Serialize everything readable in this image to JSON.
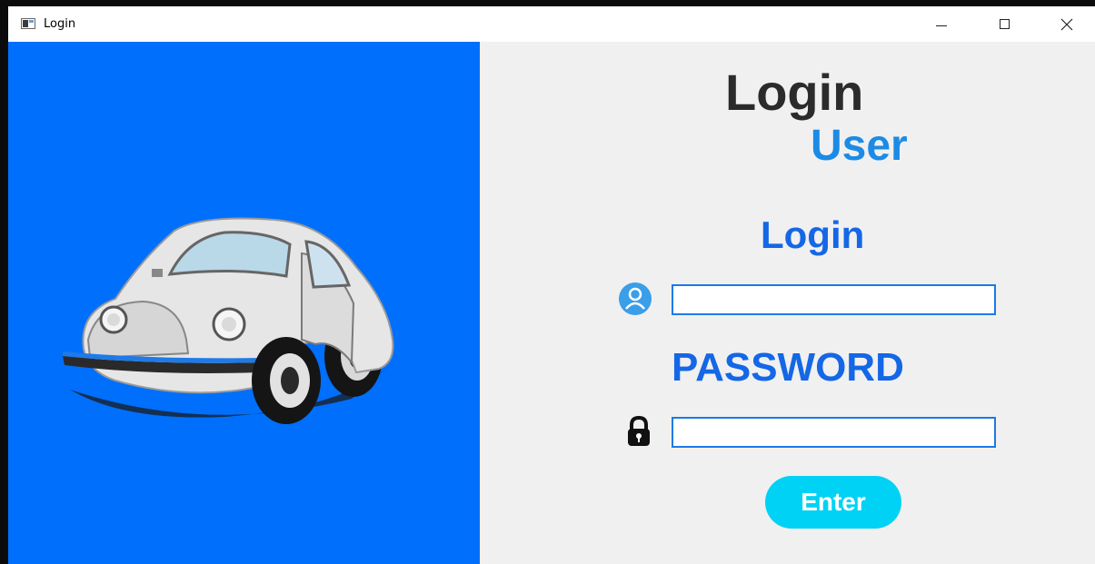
{
  "window": {
    "title": "Login",
    "controls": {
      "minimize": "minimize-icon",
      "maximize": "maximize-icon",
      "close": "close-icon"
    }
  },
  "left_panel": {
    "background": "#006ffb",
    "image": "car-illustration"
  },
  "right_panel": {
    "heading": "Login",
    "subheading": "User",
    "username_label": "Login",
    "username_value": "",
    "password_label": "PASSWORD",
    "password_value": "",
    "submit_label": "Enter",
    "icons": {
      "username": "user-icon",
      "password": "lock-icon"
    },
    "colors": {
      "accent": "#1467e6",
      "button": "#00d2f5",
      "heading": "#2b2b2b",
      "user_heading": "#1b8be6"
    }
  }
}
